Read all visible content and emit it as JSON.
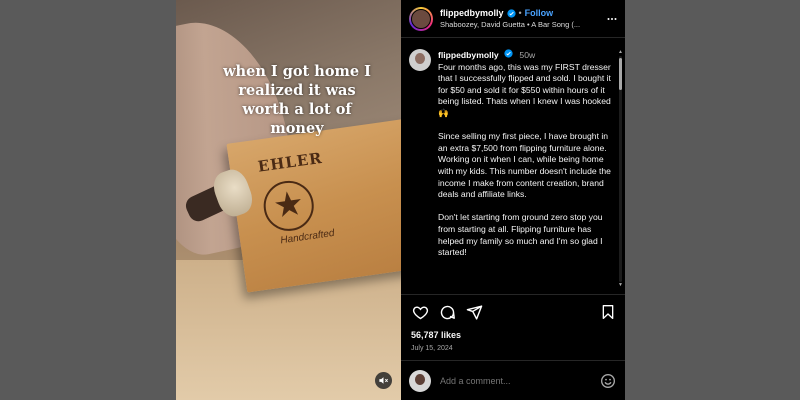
{
  "video": {
    "caption": "when I got home I realized it was worth a lot of money",
    "board_brand": "EHLER",
    "board_tag": "Handcrafted",
    "mute_icon": "muted-speaker-icon"
  },
  "header": {
    "username": "flippedbymolly",
    "follow_label": "Follow",
    "separator": "•",
    "song": "Shaboozey, David Guetta • A Bar Song (...",
    "more_icon": "more-options-icon"
  },
  "caption": {
    "username": "flippedbymolly",
    "age": "50w",
    "paragraphs": [
      "Four months ago, this was my FIRST dresser that I successfully flipped and sold. I bought it for $50 and sold it for $550 within hours of it being listed. Thats when I knew I was hooked 🙌",
      "Since selling my first piece, I have brought in an extra $7,500 from flipping furniture alone. Working on it when I can, while being home with my kids. This number doesn't include the income I make from content creation, brand deals and affiliate links.",
      "Don't let starting from ground zero stop you from starting at all. Flipping furniture has helped my family so much and I'm so glad I started!"
    ]
  },
  "actions": {
    "likes": "56,787 likes",
    "date": "July 15, 2024",
    "icons": [
      "heart-icon",
      "comment-icon",
      "share-icon",
      "bookmark-icon"
    ]
  },
  "add_comment": {
    "placeholder": "Add a comment...",
    "emoji_icon": "emoji-icon"
  },
  "colors": {
    "accent": "#4aa3ff",
    "panel_bg": "#000000",
    "backdrop": "#5a5a5a"
  }
}
